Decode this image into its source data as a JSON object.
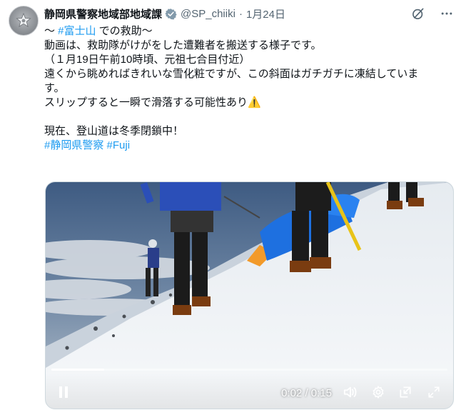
{
  "post": {
    "display_name": "静岡県警察地域部地域課",
    "handle": "@SP_chiiki",
    "separator": "·",
    "date": "1月24日",
    "avatar_icon": "police-emblem-icon",
    "verified_icon": "verified-badge-icon",
    "text": {
      "line1_prefix": "〜 ",
      "line1_hashtag": "#富士山",
      "line1_suffix": " での救助〜",
      "line2": "動画は、救助隊がけがをした遭難者を搬送する様子です。",
      "line3": "（１月19日午前10時頃、元祖七合目付近）",
      "line4": "遠くから眺めればきれいな雪化粧ですが、この斜面はガチガチに凍結していま",
      "line5": "す。",
      "line6": "スリップすると一瞬で滑落する可能性あり⚠️",
      "line7": "現在、登山道は冬季閉鎖中！",
      "hashtag1": "#静岡県警察",
      "hashtag2": "#Fuji"
    },
    "actions": {
      "grok_icon": "grok-icon",
      "more_icon": "more-options-icon"
    }
  },
  "video": {
    "time_current": "0:02",
    "time_separator": " / ",
    "time_total": "0:15",
    "progress_fraction": 0.133,
    "icons": [
      "pause-icon",
      "volume-icon",
      "settings-icon",
      "dock-icon",
      "fullscreen-icon"
    ]
  },
  "colors": {
    "accent": "#1d9bf0",
    "text": "#0f1419",
    "muted": "#536471",
    "verified": "#829aab"
  }
}
